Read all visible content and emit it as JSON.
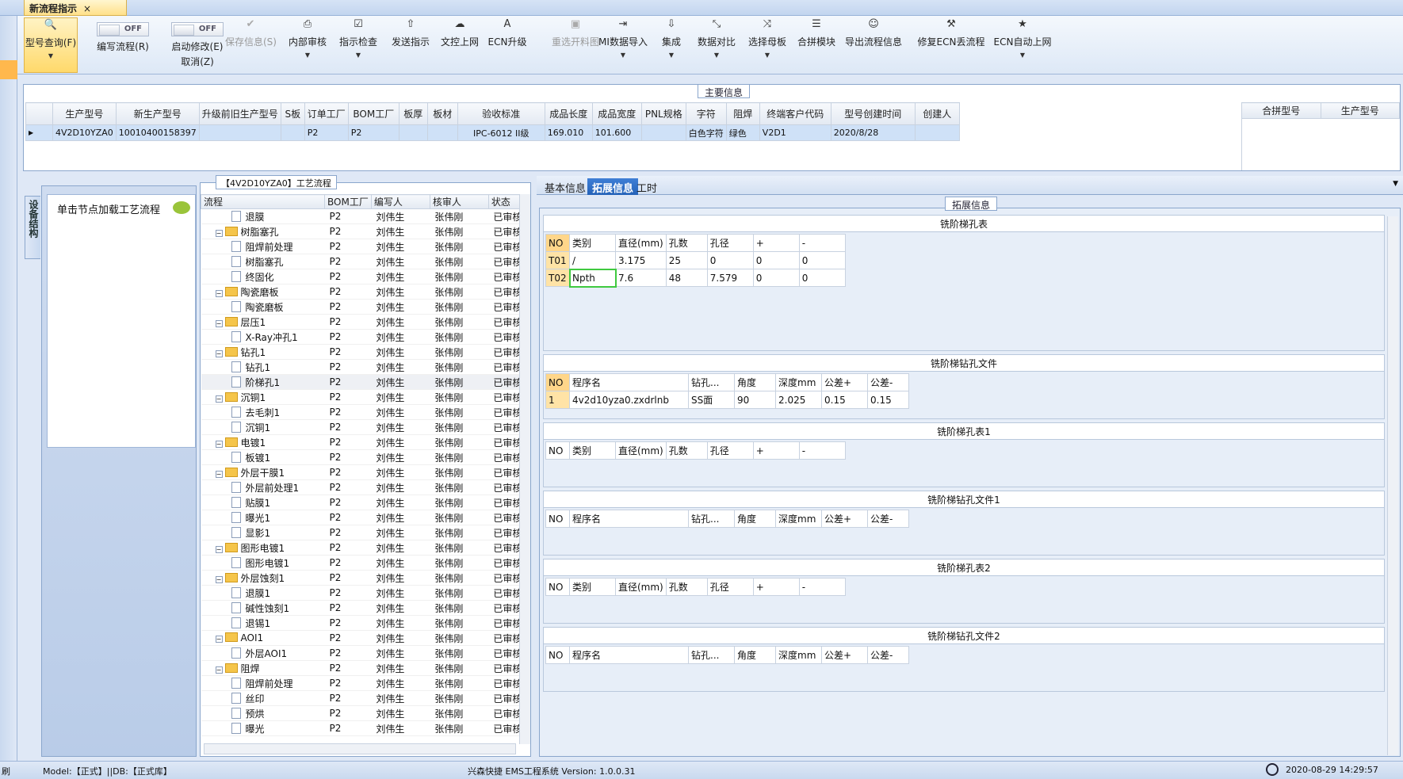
{
  "window": {
    "tab_title": "新流程指示",
    "close": "×"
  },
  "ribbon": [
    {
      "key": "model_query",
      "label": "型号查询(F)",
      "icon": "search-icon",
      "active": true
    },
    {
      "key": "edit_flow",
      "label": "编写流程(R)",
      "toggle": "OFF"
    },
    {
      "key": "start_modify",
      "label": "启动修改(E)",
      "label2": "取消(Z)",
      "toggle": "OFF"
    },
    {
      "key": "save_info",
      "label": "保存信息(S)",
      "icon": "check-icon",
      "disabled": true
    },
    {
      "key": "internal_review",
      "label": "内部审核",
      "icon": "printer-icon"
    },
    {
      "key": "instruction_check",
      "label": "指示检查",
      "icon": "checkbox-icon"
    },
    {
      "key": "send_instruction",
      "label": "发送指示",
      "icon": "upload-icon"
    },
    {
      "key": "doc_upload",
      "label": "文控上网",
      "icon": "cloud-icon"
    },
    {
      "key": "ecn_upgrade",
      "label": "ECN升级",
      "icon": "ecn-icon"
    },
    {
      "key": "reselect_drawing",
      "label": "重选开料图",
      "icon": "image-icon",
      "disabled": true
    },
    {
      "key": "mi_import",
      "label": "MI数据导入",
      "icon": "import-icon"
    },
    {
      "key": "integrate",
      "label": "集成",
      "icon": "download-icon"
    },
    {
      "key": "data_compare",
      "label": "数据对比",
      "icon": "compare-icon"
    },
    {
      "key": "select_master",
      "label": "选择母板",
      "icon": "shuffle-icon"
    },
    {
      "key": "merge_module",
      "label": "合拼模块",
      "icon": "list-icon"
    },
    {
      "key": "export_flow",
      "label": "导出流程信息",
      "icon": "smile-icon"
    },
    {
      "key": "fix_ecn",
      "label": "修复ECN丢流程",
      "icon": "wrench-icon"
    },
    {
      "key": "ecn_auto_upload",
      "label": "ECN自动上网",
      "icon": "star-icon"
    }
  ],
  "main_info": {
    "title": "主要信息",
    "columns": [
      "生产型号",
      "新生产型号",
      "升级前旧生产型号",
      "S板",
      "订单工厂",
      "BOM工厂",
      "板厚",
      "板材",
      "验收标准",
      "成品长度",
      "成品宽度",
      "PNL规格",
      "字符",
      "阻焊",
      "终端客户代码",
      "型号创建时间",
      "创建人"
    ],
    "rows": [
      [
        "4V2D10YZA0",
        "10010400158397",
        "",
        "",
        "P2",
        "P2",
        "",
        "",
        "IPC-6012 II级",
        "169.010",
        "101.600",
        "",
        "白色字符",
        "绿色",
        "V2D1",
        "2020/8/28",
        ""
      ]
    ],
    "right_columns": [
      "合拼型号",
      "生产型号"
    ]
  },
  "side": {
    "vertical_tab": "设备结构",
    "caption": "单击节点加载工艺流程"
  },
  "tree": {
    "title": "【4V2D10YZA0】工艺流程",
    "columns": [
      "流程",
      "BOM工厂",
      "编写人",
      "核审人",
      "状态"
    ],
    "rows": [
      {
        "name": "退膜",
        "level": 1,
        "type": "file",
        "f": "P2",
        "w": "刘伟生",
        "r": "张伟刚",
        "s": "已审核"
      },
      {
        "name": "树脂塞孔",
        "level": 0,
        "type": "folder",
        "f": "P2",
        "w": "刘伟生",
        "r": "张伟刚",
        "s": "已审核"
      },
      {
        "name": "阻焊前处理",
        "level": 1,
        "type": "file",
        "f": "P2",
        "w": "刘伟生",
        "r": "张伟刚",
        "s": "已审核"
      },
      {
        "name": "树脂塞孔",
        "level": 1,
        "type": "file",
        "f": "P2",
        "w": "刘伟生",
        "r": "张伟刚",
        "s": "已审核"
      },
      {
        "name": "终固化",
        "level": 1,
        "type": "file",
        "f": "P2",
        "w": "刘伟生",
        "r": "张伟刚",
        "s": "已审核"
      },
      {
        "name": "陶瓷磨板",
        "level": 0,
        "type": "folder",
        "f": "P2",
        "w": "刘伟生",
        "r": "张伟刚",
        "s": "已审核"
      },
      {
        "name": "陶瓷磨板",
        "level": 1,
        "type": "file",
        "f": "P2",
        "w": "刘伟生",
        "r": "张伟刚",
        "s": "已审核"
      },
      {
        "name": "层压1",
        "level": 0,
        "type": "folder",
        "f": "P2",
        "w": "刘伟生",
        "r": "张伟刚",
        "s": "已审核"
      },
      {
        "name": "X-Ray冲孔1",
        "level": 1,
        "type": "file",
        "f": "P2",
        "w": "刘伟生",
        "r": "张伟刚",
        "s": "已审核"
      },
      {
        "name": "钻孔1",
        "level": 0,
        "type": "folder",
        "f": "P2",
        "w": "刘伟生",
        "r": "张伟刚",
        "s": "已审核"
      },
      {
        "name": "钻孔1",
        "level": 1,
        "type": "file",
        "f": "P2",
        "w": "刘伟生",
        "r": "张伟刚",
        "s": "已审核"
      },
      {
        "name": "阶梯孔1",
        "level": 1,
        "type": "file",
        "f": "P2",
        "w": "刘伟生",
        "r": "张伟刚",
        "s": "已审核",
        "selected": true
      },
      {
        "name": "沉铜1",
        "level": 0,
        "type": "folder",
        "f": "P2",
        "w": "刘伟生",
        "r": "张伟刚",
        "s": "已审核"
      },
      {
        "name": "去毛刺1",
        "level": 1,
        "type": "file",
        "f": "P2",
        "w": "刘伟生",
        "r": "张伟刚",
        "s": "已审核"
      },
      {
        "name": "沉铜1",
        "level": 1,
        "type": "file",
        "f": "P2",
        "w": "刘伟生",
        "r": "张伟刚",
        "s": "已审核"
      },
      {
        "name": "电镀1",
        "level": 0,
        "type": "folder",
        "f": "P2",
        "w": "刘伟生",
        "r": "张伟刚",
        "s": "已审核"
      },
      {
        "name": "板镀1",
        "level": 1,
        "type": "file",
        "f": "P2",
        "w": "刘伟生",
        "r": "张伟刚",
        "s": "已审核"
      },
      {
        "name": "外层干膜1",
        "level": 0,
        "type": "folder",
        "f": "P2",
        "w": "刘伟生",
        "r": "张伟刚",
        "s": "已审核"
      },
      {
        "name": "外层前处理1",
        "level": 1,
        "type": "file",
        "f": "P2",
        "w": "刘伟生",
        "r": "张伟刚",
        "s": "已审核"
      },
      {
        "name": "贴膜1",
        "level": 1,
        "type": "file",
        "f": "P2",
        "w": "刘伟生",
        "r": "张伟刚",
        "s": "已审核"
      },
      {
        "name": "曝光1",
        "level": 1,
        "type": "file",
        "f": "P2",
        "w": "刘伟生",
        "r": "张伟刚",
        "s": "已审核"
      },
      {
        "name": "显影1",
        "level": 1,
        "type": "file",
        "f": "P2",
        "w": "刘伟生",
        "r": "张伟刚",
        "s": "已审核"
      },
      {
        "name": "图形电镀1",
        "level": 0,
        "type": "folder",
        "f": "P2",
        "w": "刘伟生",
        "r": "张伟刚",
        "s": "已审核"
      },
      {
        "name": "图形电镀1",
        "level": 1,
        "type": "file",
        "f": "P2",
        "w": "刘伟生",
        "r": "张伟刚",
        "s": "已审核"
      },
      {
        "name": "外层蚀刻1",
        "level": 0,
        "type": "folder",
        "f": "P2",
        "w": "刘伟生",
        "r": "张伟刚",
        "s": "已审核"
      },
      {
        "name": "退膜1",
        "level": 1,
        "type": "file",
        "f": "P2",
        "w": "刘伟生",
        "r": "张伟刚",
        "s": "已审核"
      },
      {
        "name": "碱性蚀刻1",
        "level": 1,
        "type": "file",
        "f": "P2",
        "w": "刘伟生",
        "r": "张伟刚",
        "s": "已审核"
      },
      {
        "name": "退锡1",
        "level": 1,
        "type": "file",
        "f": "P2",
        "w": "刘伟生",
        "r": "张伟刚",
        "s": "已审核"
      },
      {
        "name": "AOI1",
        "level": 0,
        "type": "folder",
        "f": "P2",
        "w": "刘伟生",
        "r": "张伟刚",
        "s": "已审核"
      },
      {
        "name": "外层AOI1",
        "level": 1,
        "type": "file",
        "f": "P2",
        "w": "刘伟生",
        "r": "张伟刚",
        "s": "已审核"
      },
      {
        "name": "阻焊",
        "level": 0,
        "type": "folder",
        "f": "P2",
        "w": "刘伟生",
        "r": "张伟刚",
        "s": "已审核"
      },
      {
        "name": "阻焊前处理",
        "level": 1,
        "type": "file",
        "f": "P2",
        "w": "刘伟生",
        "r": "张伟刚",
        "s": "已审核"
      },
      {
        "name": "丝印",
        "level": 1,
        "type": "file",
        "f": "P2",
        "w": "刘伟生",
        "r": "张伟刚",
        "s": "已审核"
      },
      {
        "name": "预烘",
        "level": 1,
        "type": "file",
        "f": "P2",
        "w": "刘伟生",
        "r": "张伟刚",
        "s": "已审核"
      },
      {
        "name": "曝光",
        "level": 1,
        "type": "file",
        "f": "P2",
        "w": "刘伟生",
        "r": "张伟刚",
        "s": "已审核"
      }
    ]
  },
  "right": {
    "tabs": [
      "基本信息",
      "拓展信息",
      "工时"
    ],
    "active_tab": 1,
    "section_title": "拓展信息",
    "blocks": [
      {
        "title": "铣阶梯孔表",
        "kind": "hole",
        "rows": [
          [
            "T01",
            "/",
            "3.175",
            "25",
            "0",
            "0",
            "0"
          ],
          [
            "T02",
            "Npth",
            "7.6",
            "48",
            "7.579",
            "0",
            "0"
          ]
        ],
        "body_h": 150
      },
      {
        "title": "铣阶梯钻孔文件",
        "kind": "drill",
        "rows": [
          [
            "1",
            "4v2d10yza0.zxdrlnb",
            "SS面",
            "90",
            "2.025",
            "0.15",
            "0.15"
          ]
        ],
        "body_h": 60
      },
      {
        "title": "铣阶梯孔表1",
        "kind": "hole",
        "rows": [],
        "body_h": 60
      },
      {
        "title": "铣阶梯钻孔文件1",
        "kind": "drill",
        "rows": [],
        "body_h": 60
      },
      {
        "title": "铣阶梯孔表2",
        "kind": "hole",
        "rows": [],
        "body_h": 60
      },
      {
        "title": "铣阶梯钻孔文件2",
        "kind": "drill",
        "rows": [],
        "body_h": 60
      }
    ],
    "hole_cols": [
      "NO",
      "类别",
      "直径(mm)",
      "孔数",
      "孔径",
      "+",
      "-"
    ],
    "drill_cols": [
      "NO",
      "程序名",
      "钻孔...",
      "角度",
      "深度mm",
      "公差+",
      "公差-"
    ]
  },
  "status": {
    "left": "Model:【正式】||DB:【正式库】",
    "center": "兴森快捷 EMS工程系统 Version: 1.0.0.31",
    "time": "2020-08-29 14:29:57",
    "edge": "刷"
  }
}
